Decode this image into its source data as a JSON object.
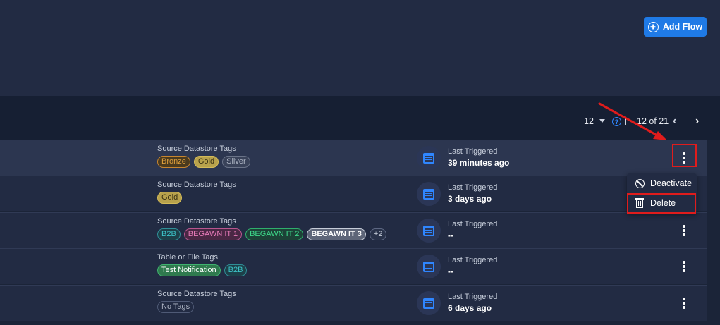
{
  "header": {
    "add_flow_label": "Add Flow"
  },
  "pagination": {
    "page_size": "12",
    "range": "12 of 21",
    "prev_icon": "chevron-left",
    "next_icon": "chevron-right"
  },
  "rows": [
    {
      "tag_title": "Source Datastore Tags",
      "tags": [
        "Bronze",
        "Gold",
        "Silver"
      ],
      "last_triggered_label": "Last Triggered",
      "last_triggered_value": "39 minutes ago"
    },
    {
      "tag_title": "Source Datastore Tags",
      "tags": [
        "Gold"
      ],
      "last_triggered_label": "Last Triggered",
      "last_triggered_value": "3 days ago"
    },
    {
      "tag_title": "Source Datastore Tags",
      "tags": [
        "B2B",
        "BEGAWN IT 1",
        "BEGAWN IT 2",
        "BEGAWN IT 3",
        "+2"
      ],
      "last_triggered_label": "Last Triggered",
      "last_triggered_value": "--"
    },
    {
      "tag_title": "Table or File Tags",
      "tags": [
        "Test Notification",
        "B2B"
      ],
      "last_triggered_label": "Last Triggered",
      "last_triggered_value": "--"
    },
    {
      "tag_title": "Source Datastore Tags",
      "tags": [
        "No Tags"
      ],
      "last_triggered_label": "Last Triggered",
      "last_triggered_value": "6 days ago"
    }
  ],
  "menu": {
    "deactivate_label": "Deactivate",
    "delete_label": "Delete"
  },
  "colors": {
    "accent": "#1f7ae6",
    "highlight": "#e01c1c"
  }
}
